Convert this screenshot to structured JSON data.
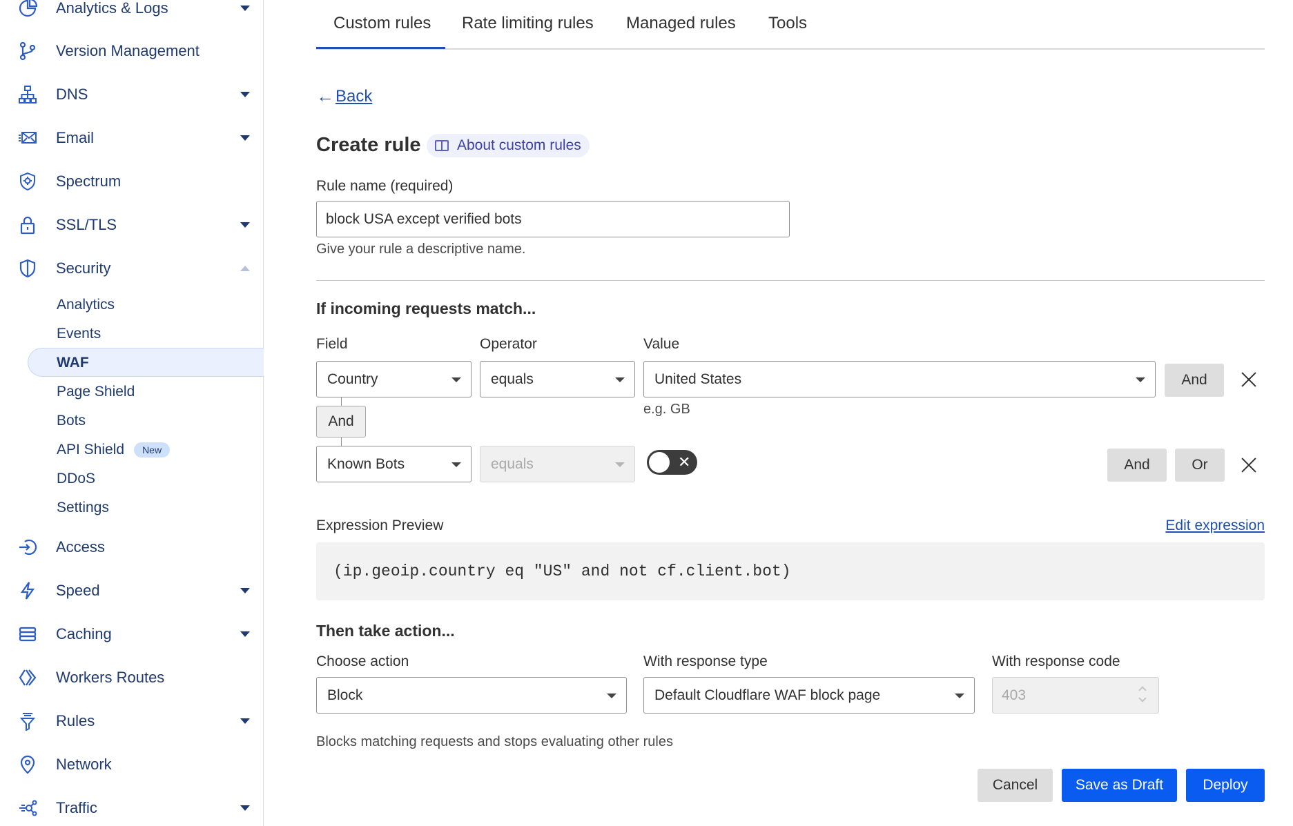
{
  "sidebar": {
    "items": [
      {
        "label": "Analytics & Logs",
        "icon": "pie-chart-icon",
        "caret": true
      },
      {
        "label": "Version Management",
        "icon": "branch-icon",
        "caret": false
      },
      {
        "label": "DNS",
        "icon": "network-tree-icon",
        "caret": true
      },
      {
        "label": "Email",
        "icon": "envelope-icon",
        "caret": true
      },
      {
        "label": "Spectrum",
        "icon": "shield-gear-icon",
        "caret": false
      },
      {
        "label": "SSL/TLS",
        "icon": "lock-icon",
        "caret": true
      },
      {
        "label": "Security",
        "icon": "shield-icon",
        "caret": "up"
      },
      {
        "label": "Access",
        "icon": "login-arrow-icon",
        "caret": false
      },
      {
        "label": "Speed",
        "icon": "lightning-icon",
        "caret": true
      },
      {
        "label": "Caching",
        "icon": "server-stack-icon",
        "caret": true
      },
      {
        "label": "Workers Routes",
        "icon": "workers-icon",
        "caret": false
      },
      {
        "label": "Rules",
        "icon": "funnel-icon",
        "caret": true
      },
      {
        "label": "Network",
        "icon": "location-pin-icon",
        "caret": false
      },
      {
        "label": "Traffic",
        "icon": "traffic-nodes-icon",
        "caret": true
      }
    ],
    "security_sub": [
      {
        "label": "Analytics"
      },
      {
        "label": "Events"
      },
      {
        "label": "WAF",
        "active": true
      },
      {
        "label": "Page Shield"
      },
      {
        "label": "Bots"
      },
      {
        "label": "API Shield",
        "badge": "New"
      },
      {
        "label": "DDoS"
      },
      {
        "label": "Settings"
      }
    ]
  },
  "tabs": [
    "Custom rules",
    "Rate limiting rules",
    "Managed rules",
    "Tools"
  ],
  "active_tab": "Custom rules",
  "back_label": "Back",
  "title": "Create rule",
  "about_link": "About custom rules",
  "rule_name": {
    "label": "Rule name (required)",
    "value": "block USA except verified bots",
    "help": "Give your rule a descriptive name."
  },
  "match": {
    "title": "If incoming requests match...",
    "field_label": "Field",
    "operator_label": "Operator",
    "value_label": "Value",
    "row1": {
      "field": "Country",
      "operator": "equals",
      "value": "United States",
      "value_hint": "e.g. GB",
      "and_btn": "And"
    },
    "connector": "And",
    "row2": {
      "field": "Known Bots",
      "operator": "equals",
      "toggle_on": false,
      "and_btn": "And",
      "or_btn": "Or"
    }
  },
  "expression": {
    "label": "Expression Preview",
    "edit_link": "Edit expression",
    "code": "(ip.geoip.country eq \"US\" and not cf.client.bot)"
  },
  "action": {
    "title": "Then take action...",
    "choose_label": "Choose action",
    "choose_value": "Block",
    "type_label": "With response type",
    "type_value": "Default Cloudflare WAF block page",
    "code_label": "With response code",
    "code_value": "403",
    "help": "Blocks matching requests and stops evaluating other rules"
  },
  "footer": {
    "cancel": "Cancel",
    "draft": "Save as Draft",
    "deploy": "Deploy"
  },
  "colors": {
    "primary": "#0a5bf0",
    "nav_text": "#1f3a6e",
    "nav_icon": "#2c5cc5",
    "active_bg": "#eaf0fd"
  }
}
